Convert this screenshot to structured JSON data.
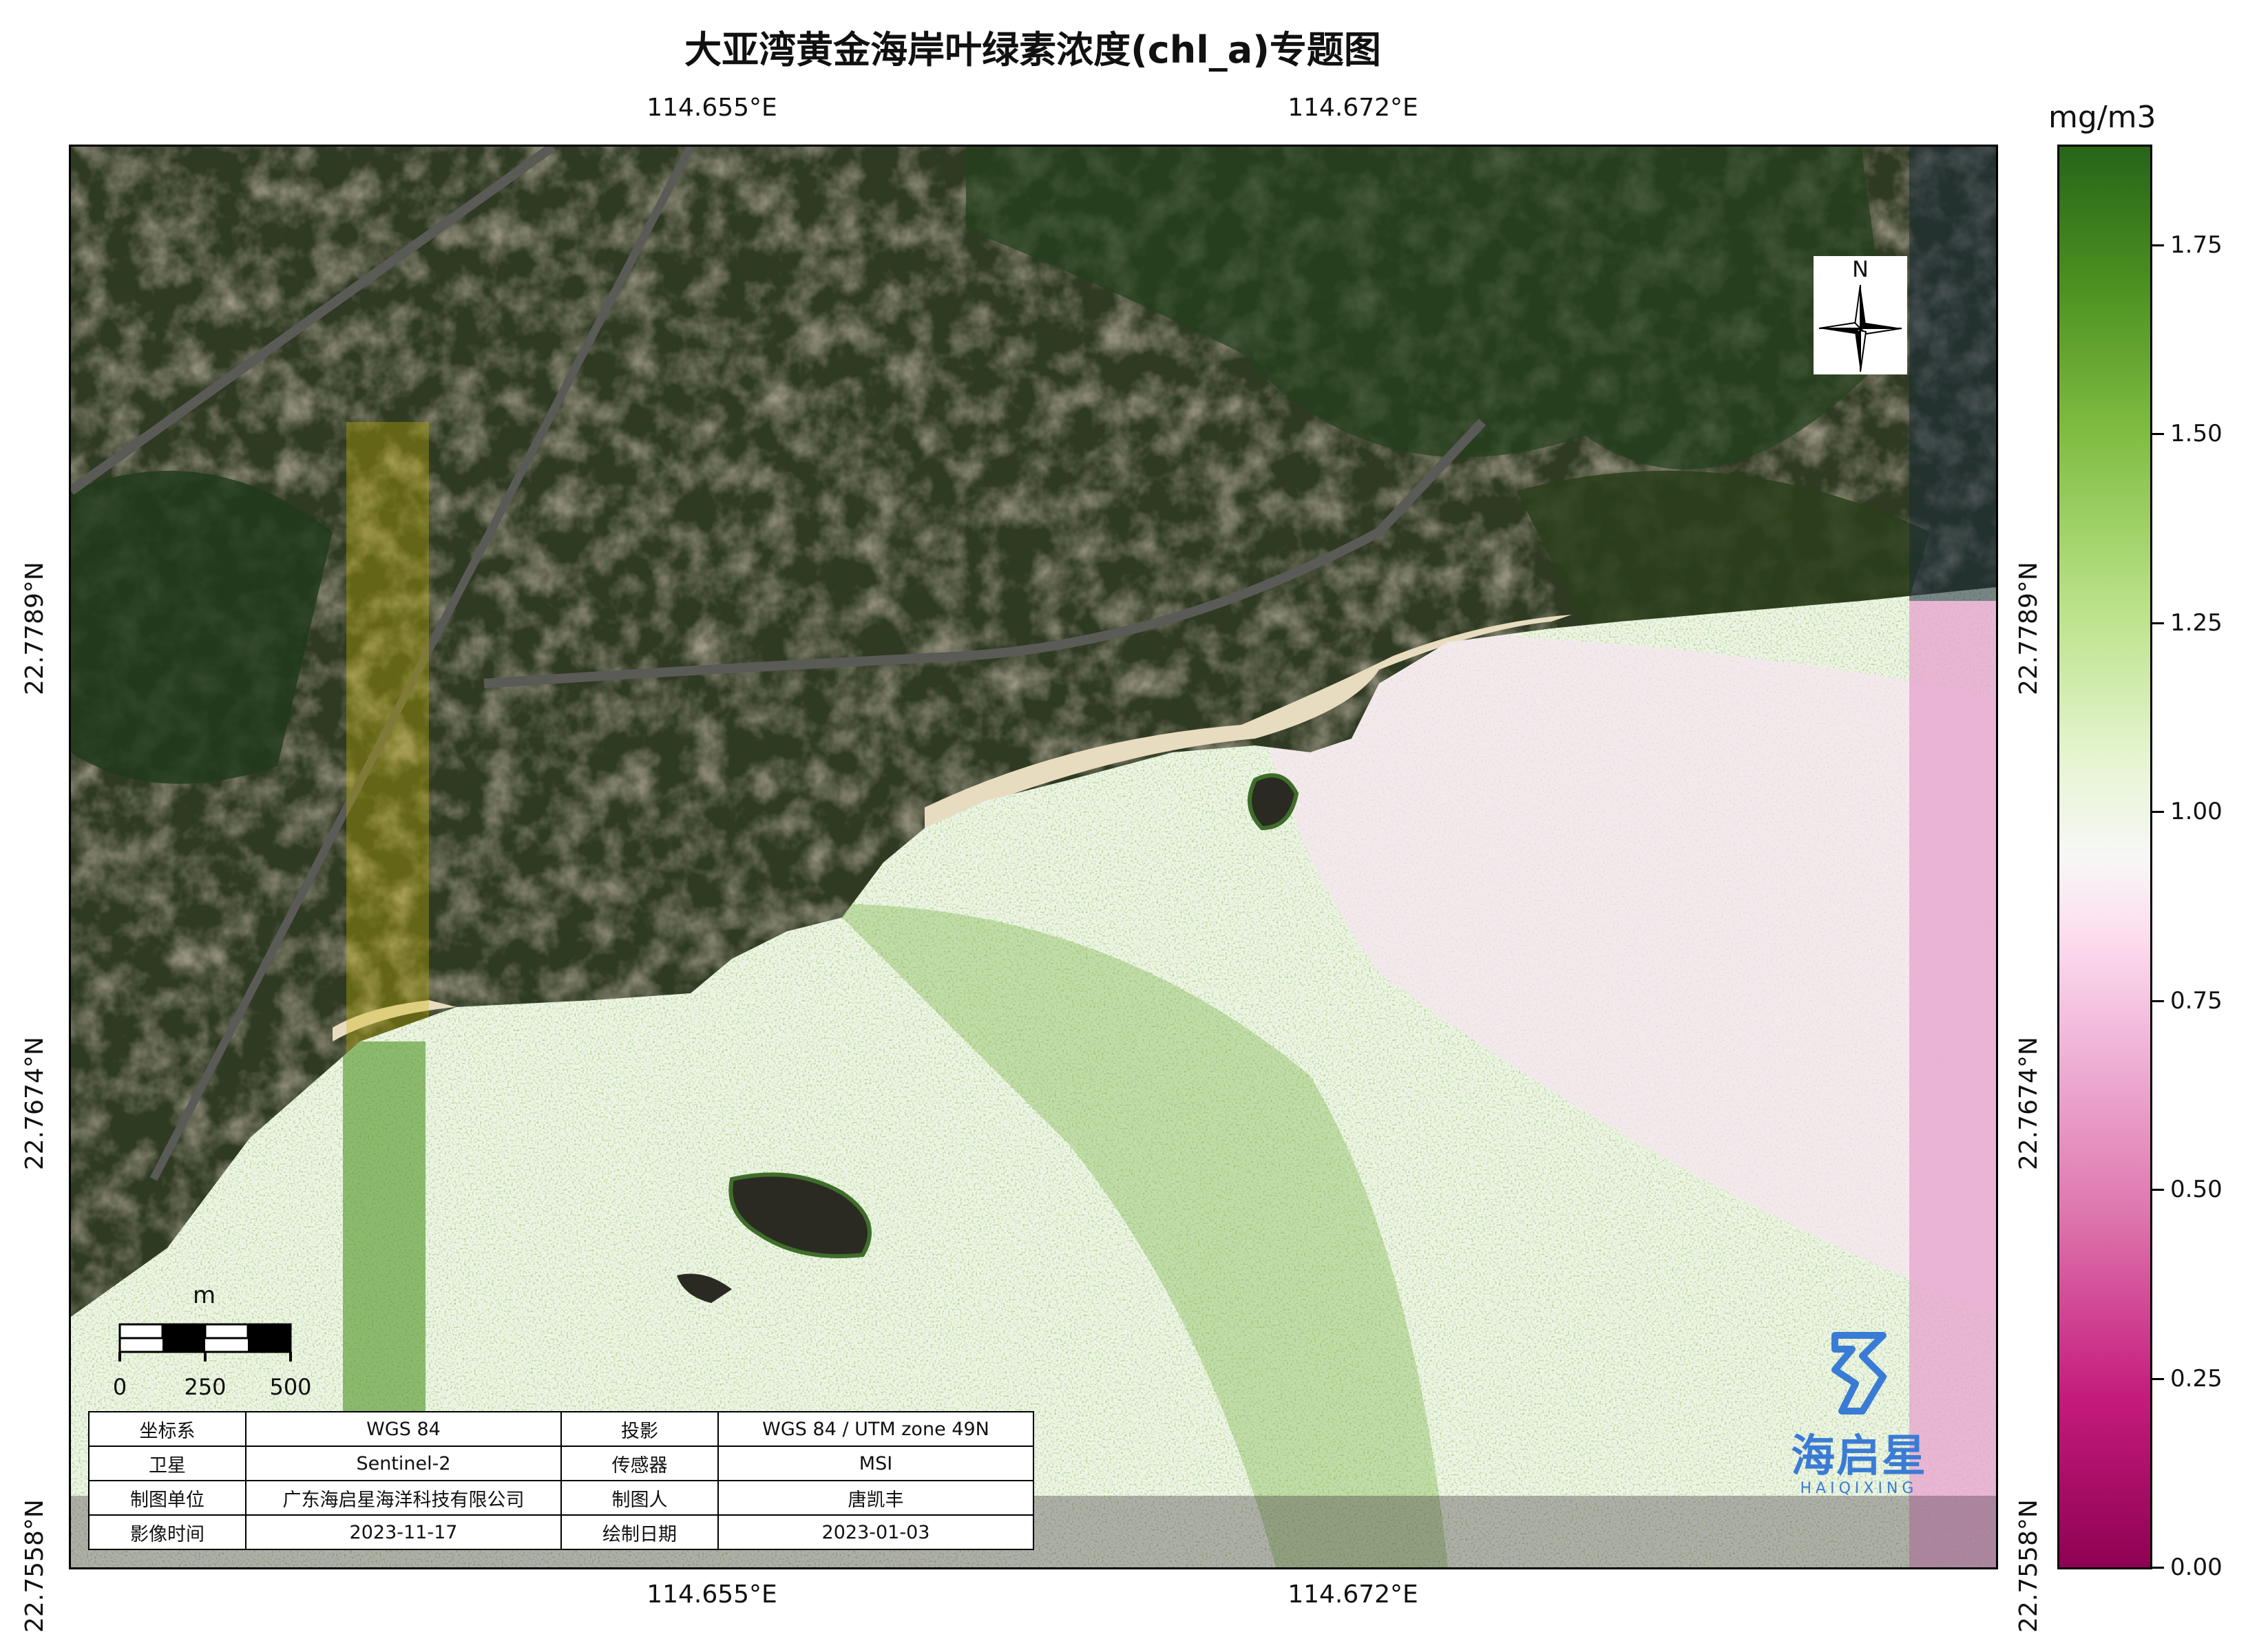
{
  "title": "大亚湾黄金海岸叶绿素浓度(chl_a)专题图",
  "colorbar": {
    "unit": "mg/m3",
    "ticks": [
      "0.00",
      "0.25",
      "0.50",
      "0.75",
      "1.00",
      "1.25",
      "1.50",
      "1.75"
    ],
    "tick_values": [
      0.0,
      0.25,
      0.5,
      0.75,
      1.0,
      1.25,
      1.5,
      1.75
    ],
    "range": [
      0.0,
      1.88
    ],
    "colormap_colors": [
      "#8e0152",
      "#de77ae",
      "#f7f7f7",
      "#7fbc41",
      "#276419"
    ]
  },
  "axes": {
    "lon_ticks": [
      "114.655°E",
      "114.672°E"
    ],
    "lat_ticks": [
      "22.7789°N",
      "22.7674°N",
      "22.7558°N"
    ]
  },
  "north_arrow": {
    "label": "N",
    "icon": "compass-rose-icon"
  },
  "scale_bar": {
    "unit": "m",
    "labels": [
      "0",
      "250",
      "500"
    ]
  },
  "info_table": [
    [
      "坐标系",
      "WGS 84",
      "投影",
      "WGS 84 / UTM zone 49N"
    ],
    [
      "卫星",
      "Sentinel-2",
      "传感器",
      "MSI"
    ],
    [
      "制图单位",
      "广东海启星海洋科技有限公司",
      "制图人",
      "唐凯丰"
    ],
    [
      "影像时间",
      "2023-11-17",
      "绘制日期",
      "2023-01-03"
    ]
  ],
  "logo": {
    "name": "海启星",
    "name_en": "HAIQIXING",
    "icon": "haiqixing-logo-icon"
  }
}
